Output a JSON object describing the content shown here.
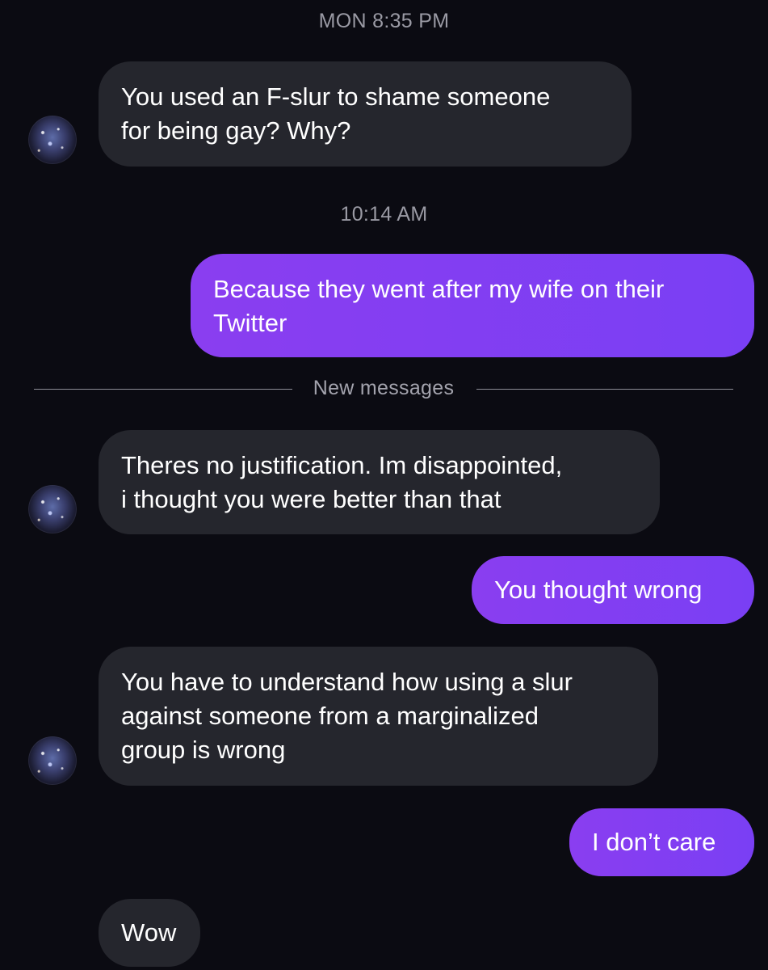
{
  "thread": {
    "timestamps": [
      "MON 8:35 PM",
      "10:14 AM"
    ],
    "divider_label": "New messages",
    "messages": [
      {
        "sender": "them",
        "lines": [
          "You used an F-slur to shame someone",
          "for being gay? Why?"
        ]
      },
      {
        "sender": "me",
        "lines": [
          "Because they went after my wife on their",
          "Twitter"
        ]
      },
      {
        "sender": "them",
        "lines": [
          "Theres no justification. Im disappointed,",
          "i thought you were better than that"
        ]
      },
      {
        "sender": "me",
        "lines": [
          "You thought wrong"
        ]
      },
      {
        "sender": "them",
        "lines": [
          "You have to understand how using a slur",
          "against someone from a marginalized",
          "group is wrong"
        ]
      },
      {
        "sender": "me",
        "lines": [
          "I don’t care"
        ]
      },
      {
        "sender": "them",
        "lines": [
          "Wow"
        ]
      }
    ]
  },
  "colors": {
    "background": "#0b0b12",
    "incoming_bubble": "#25262d",
    "outgoing_bubble": "#8a3ef0",
    "timestamp_text": "#9a9aa4"
  },
  "icons": {
    "contact_avatar": "galaxy-avatar"
  }
}
